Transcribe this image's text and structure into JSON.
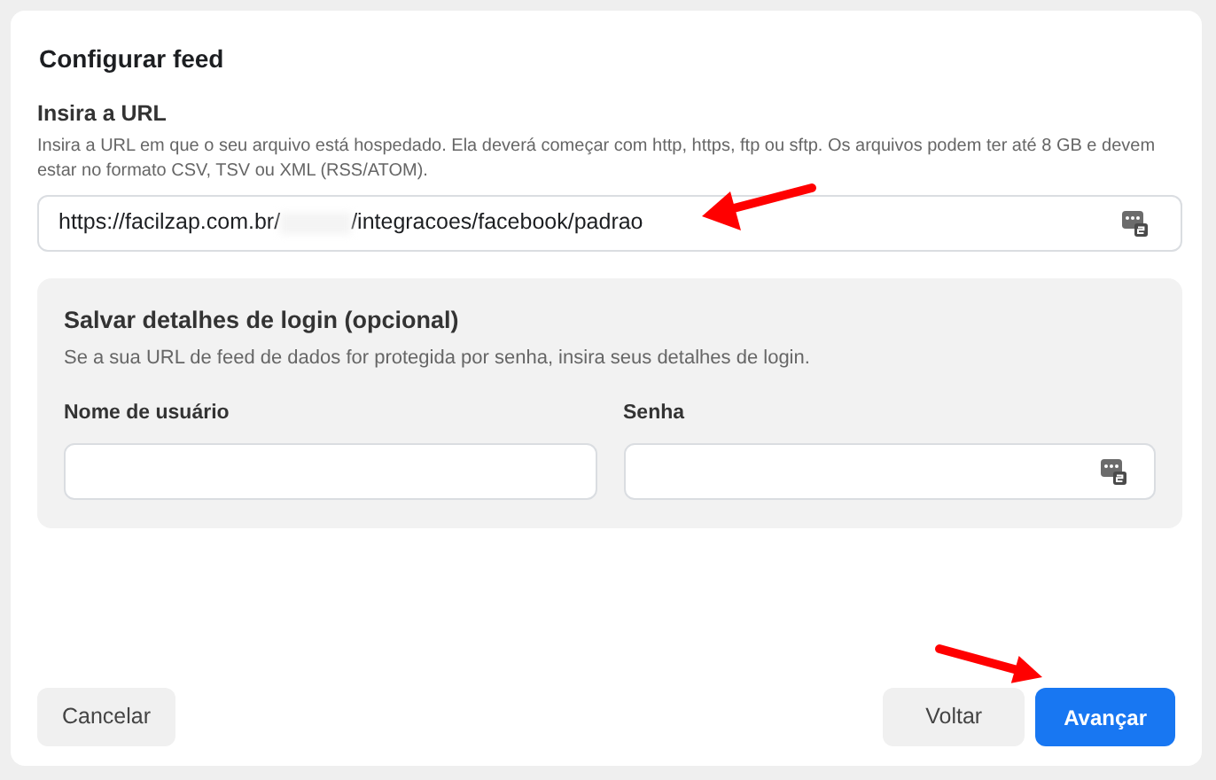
{
  "dialog": {
    "title": "Configurar feed"
  },
  "url_section": {
    "label": "Insira a URL",
    "help": "Insira a URL em que o seu arquivo está hospedado. Ela deverá começar com http, https, ftp ou sftp. Os arquivos podem ter até 8 GB e devem estar no formato CSV, TSV ou XML (RSS/ATOM).",
    "value_start": "https://facilzap.com.br/",
    "value_end": "/integracoes/facebook/padrao"
  },
  "login_section": {
    "title": "Salvar detalhes de login (opcional)",
    "help": "Se a sua URL de feed de dados for protegida por senha, insira seus detalhes de login.",
    "fields": [
      {
        "label": "Nome de usuário",
        "kind": "text"
      },
      {
        "label": "Senha",
        "kind": "password"
      }
    ]
  },
  "buttons": [
    {
      "label": "Cancelar",
      "kind": "secondary"
    },
    {
      "label": "Voltar",
      "kind": "secondary"
    },
    {
      "label": "Avançar",
      "kind": "primary"
    }
  ]
}
